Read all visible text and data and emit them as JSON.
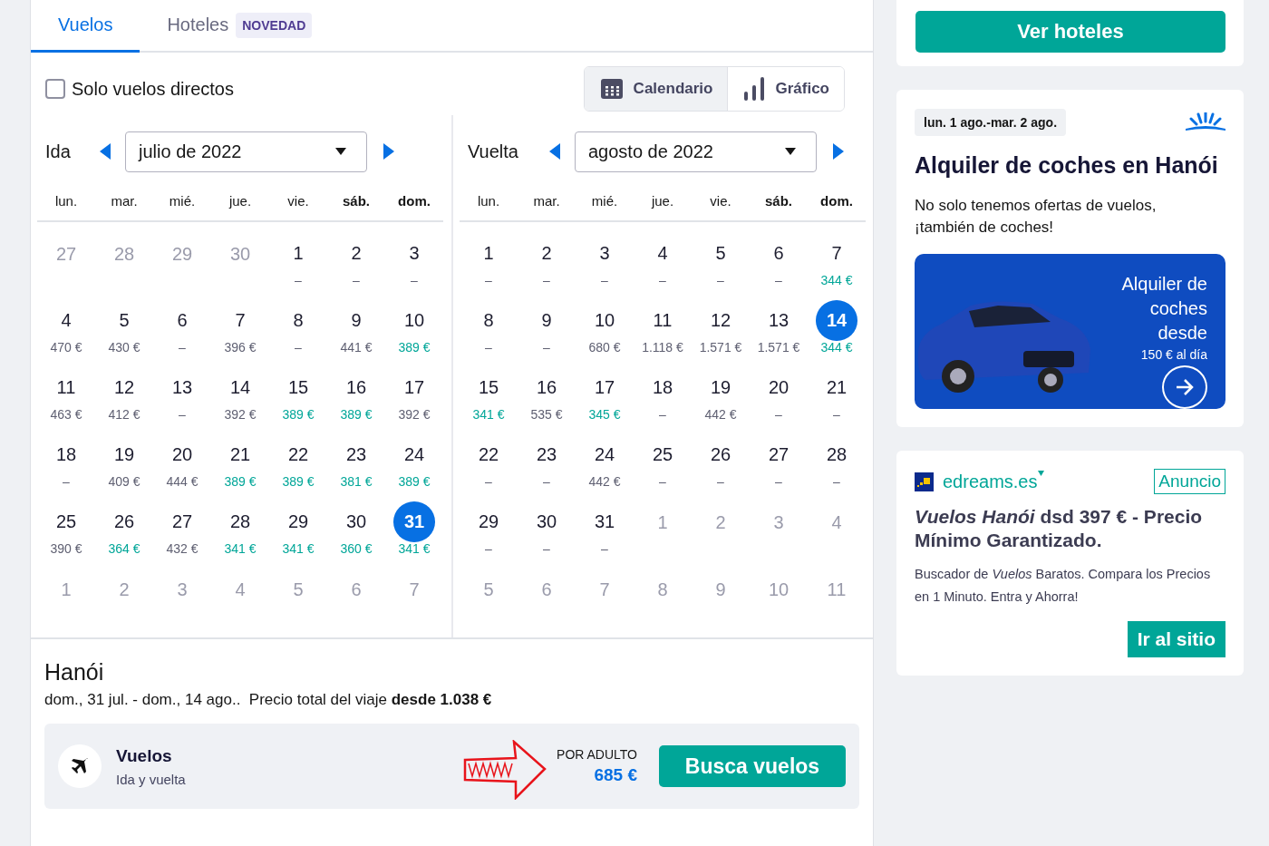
{
  "tabs": [
    {
      "label": "Vuelos",
      "selected": true
    },
    {
      "label": "Hoteles",
      "selected": false,
      "badge": "NOVEDAD"
    }
  ],
  "direct_only": {
    "label": "Solo vuelos directos",
    "checked": false
  },
  "view_toggle": [
    {
      "label": "Calendario",
      "kind": "calendar",
      "selected": true
    },
    {
      "label": "Gráfico",
      "kind": "chart",
      "selected": false
    }
  ],
  "months": [
    {
      "label": "Ida",
      "month": "julio de 2022",
      "weekdays": [
        {
          "label": "lun.",
          "weekend": false
        },
        {
          "label": "mar.",
          "weekend": false
        },
        {
          "label": "mié.",
          "weekend": false
        },
        {
          "label": "jue.",
          "weekend": false
        },
        {
          "label": "vie.",
          "weekend": false
        },
        {
          "label": "sáb.",
          "weekend": true
        },
        {
          "label": "dom.",
          "weekend": true
        }
      ],
      "days": [
        {
          "day": "27",
          "outside": true,
          "selected": false
        },
        {
          "day": "28",
          "outside": true,
          "selected": false
        },
        {
          "day": "29",
          "outside": true,
          "selected": false
        },
        {
          "day": "30",
          "outside": true,
          "selected": false
        },
        {
          "day": "1",
          "price": "–",
          "outside": false,
          "cheap": false,
          "selected": false
        },
        {
          "day": "2",
          "price": "–",
          "outside": false,
          "cheap": false,
          "selected": false
        },
        {
          "day": "3",
          "price": "–",
          "outside": false,
          "cheap": false,
          "selected": false
        },
        {
          "day": "4",
          "price": "470 €",
          "outside": false,
          "cheap": false,
          "selected": false
        },
        {
          "day": "5",
          "price": "430 €",
          "outside": false,
          "cheap": false,
          "selected": false
        },
        {
          "day": "6",
          "price": "–",
          "outside": false,
          "cheap": false,
          "selected": false
        },
        {
          "day": "7",
          "price": "396 €",
          "outside": false,
          "cheap": false,
          "selected": false
        },
        {
          "day": "8",
          "price": "–",
          "outside": false,
          "cheap": false,
          "selected": false
        },
        {
          "day": "9",
          "price": "441 €",
          "outside": false,
          "cheap": false,
          "selected": false
        },
        {
          "day": "10",
          "price": "389 €",
          "outside": false,
          "cheap": true,
          "selected": false
        },
        {
          "day": "11",
          "price": "463 €",
          "outside": false,
          "cheap": false,
          "selected": false
        },
        {
          "day": "12",
          "price": "412 €",
          "outside": false,
          "cheap": false,
          "selected": false
        },
        {
          "day": "13",
          "price": "–",
          "outside": false,
          "cheap": false,
          "selected": false
        },
        {
          "day": "14",
          "price": "392 €",
          "outside": false,
          "cheap": false,
          "selected": false
        },
        {
          "day": "15",
          "price": "389 €",
          "outside": false,
          "cheap": true,
          "selected": false
        },
        {
          "day": "16",
          "price": "389 €",
          "outside": false,
          "cheap": true,
          "selected": false
        },
        {
          "day": "17",
          "price": "392 €",
          "outside": false,
          "cheap": false,
          "selected": false
        },
        {
          "day": "18",
          "price": "–",
          "outside": false,
          "cheap": false,
          "selected": false
        },
        {
          "day": "19",
          "price": "409 €",
          "outside": false,
          "cheap": false,
          "selected": false
        },
        {
          "day": "20",
          "price": "444 €",
          "outside": false,
          "cheap": false,
          "selected": false
        },
        {
          "day": "21",
          "price": "389 €",
          "outside": false,
          "cheap": true,
          "selected": false
        },
        {
          "day": "22",
          "price": "389 €",
          "outside": false,
          "cheap": true,
          "selected": false
        },
        {
          "day": "23",
          "price": "381 €",
          "outside": false,
          "cheap": true,
          "selected": false
        },
        {
          "day": "24",
          "price": "389 €",
          "outside": false,
          "cheap": true,
          "selected": false
        },
        {
          "day": "25",
          "price": "390 €",
          "outside": false,
          "cheap": false,
          "selected": false
        },
        {
          "day": "26",
          "price": "364 €",
          "outside": false,
          "cheap": true,
          "selected": false
        },
        {
          "day": "27",
          "price": "432 €",
          "outside": false,
          "cheap": false,
          "selected": false
        },
        {
          "day": "28",
          "price": "341 €",
          "outside": false,
          "cheap": true,
          "selected": false
        },
        {
          "day": "29",
          "price": "341 €",
          "outside": false,
          "cheap": true,
          "selected": false
        },
        {
          "day": "30",
          "price": "360 €",
          "outside": false,
          "cheap": true,
          "selected": false
        },
        {
          "day": "31",
          "price": "341 €",
          "outside": false,
          "cheap": true,
          "selected": true
        },
        {
          "day": "1",
          "outside": true,
          "selected": false
        },
        {
          "day": "2",
          "outside": true,
          "selected": false
        },
        {
          "day": "3",
          "outside": true,
          "selected": false
        },
        {
          "day": "4",
          "outside": true,
          "selected": false
        },
        {
          "day": "5",
          "outside": true,
          "selected": false
        },
        {
          "day": "6",
          "outside": true,
          "selected": false
        },
        {
          "day": "7",
          "outside": true,
          "selected": false
        }
      ]
    },
    {
      "label": "Vuelta",
      "month": "agosto de 2022",
      "weekdays": [
        {
          "label": "lun.",
          "weekend": false
        },
        {
          "label": "mar.",
          "weekend": false
        },
        {
          "label": "mié.",
          "weekend": false
        },
        {
          "label": "jue.",
          "weekend": false
        },
        {
          "label": "vie.",
          "weekend": false
        },
        {
          "label": "sáb.",
          "weekend": true
        },
        {
          "label": "dom.",
          "weekend": true
        }
      ],
      "days": [
        {
          "day": "1",
          "price": "–",
          "outside": false,
          "cheap": false,
          "selected": false
        },
        {
          "day": "2",
          "price": "–",
          "outside": false,
          "cheap": false,
          "selected": false
        },
        {
          "day": "3",
          "price": "–",
          "outside": false,
          "cheap": false,
          "selected": false
        },
        {
          "day": "4",
          "price": "–",
          "outside": false,
          "cheap": false,
          "selected": false
        },
        {
          "day": "5",
          "price": "–",
          "outside": false,
          "cheap": false,
          "selected": false
        },
        {
          "day": "6",
          "price": "–",
          "outside": false,
          "cheap": false,
          "selected": false
        },
        {
          "day": "7",
          "price": "344 €",
          "outside": false,
          "cheap": true,
          "selected": false
        },
        {
          "day": "8",
          "price": "–",
          "outside": false,
          "cheap": false,
          "selected": false
        },
        {
          "day": "9",
          "price": "–",
          "outside": false,
          "cheap": false,
          "selected": false
        },
        {
          "day": "10",
          "price": "680 €",
          "outside": false,
          "cheap": false,
          "selected": false
        },
        {
          "day": "11",
          "price": "1.118 €",
          "outside": false,
          "cheap": false,
          "selected": false
        },
        {
          "day": "12",
          "price": "1.571 €",
          "outside": false,
          "cheap": false,
          "selected": false
        },
        {
          "day": "13",
          "price": "1.571 €",
          "outside": false,
          "cheap": false,
          "selected": false
        },
        {
          "day": "14",
          "price": "344 €",
          "outside": false,
          "cheap": true,
          "selected": true
        },
        {
          "day": "15",
          "price": "341 €",
          "outside": false,
          "cheap": true,
          "selected": false
        },
        {
          "day": "16",
          "price": "535 €",
          "outside": false,
          "cheap": false,
          "selected": false
        },
        {
          "day": "17",
          "price": "345 €",
          "outside": false,
          "cheap": true,
          "selected": false
        },
        {
          "day": "18",
          "price": "–",
          "outside": false,
          "cheap": false,
          "selected": false
        },
        {
          "day": "19",
          "price": "442 €",
          "outside": false,
          "cheap": false,
          "selected": false
        },
        {
          "day": "20",
          "price": "–",
          "outside": false,
          "cheap": false,
          "selected": false
        },
        {
          "day": "21",
          "price": "–",
          "outside": false,
          "cheap": false,
          "selected": false
        },
        {
          "day": "22",
          "price": "–",
          "outside": false,
          "cheap": false,
          "selected": false
        },
        {
          "day": "23",
          "price": "–",
          "outside": false,
          "cheap": false,
          "selected": false
        },
        {
          "day": "24",
          "price": "442 €",
          "outside": false,
          "cheap": false,
          "selected": false
        },
        {
          "day": "25",
          "price": "–",
          "outside": false,
          "cheap": false,
          "selected": false
        },
        {
          "day": "26",
          "price": "–",
          "outside": false,
          "cheap": false,
          "selected": false
        },
        {
          "day": "27",
          "price": "–",
          "outside": false,
          "cheap": false,
          "selected": false
        },
        {
          "day": "28",
          "price": "–",
          "outside": false,
          "cheap": false,
          "selected": false
        },
        {
          "day": "29",
          "price": "–",
          "outside": false,
          "cheap": false,
          "selected": false
        },
        {
          "day": "30",
          "price": "–",
          "outside": false,
          "cheap": false,
          "selected": false
        },
        {
          "day": "31",
          "price": "–",
          "outside": false,
          "cheap": false,
          "selected": false
        },
        {
          "day": "1",
          "outside": true,
          "selected": false
        },
        {
          "day": "2",
          "outside": true,
          "selected": false
        },
        {
          "day": "3",
          "outside": true,
          "selected": false
        },
        {
          "day": "4",
          "outside": true,
          "selected": false
        },
        {
          "day": "5",
          "outside": true,
          "selected": false
        },
        {
          "day": "6",
          "outside": true,
          "selected": false
        },
        {
          "day": "7",
          "outside": true,
          "selected": false
        },
        {
          "day": "8",
          "outside": true,
          "selected": false
        },
        {
          "day": "9",
          "outside": true,
          "selected": false
        },
        {
          "day": "10",
          "outside": true,
          "selected": false
        },
        {
          "day": "11",
          "outside": true,
          "selected": false
        }
      ]
    }
  ],
  "summary": {
    "city": "Hanói",
    "details": "dom., 31 jul. - dom., 14 ago..  Precio total del viaje **desde 1.038 €**",
    "flight": {
      "title": "Vuelos",
      "subtitle": "Ida y vuelta",
      "price_label": "POR ADULTO",
      "price": "685 €",
      "button": "Busca vuelos"
    }
  },
  "hotel_card": {
    "button": "Ver hoteles"
  },
  "car_card": {
    "dates": "lun. 1 ago.-mar. 2 ago.",
    "title": "Alquiler de coches en Hanói",
    "text": "No solo tenemos ofertas de vuelos, ¡también de coches!",
    "promo": "Alquiler de coches desde",
    "promo_price": "150 € al día"
  },
  "ad": {
    "domain": "edreams.es",
    "label": "Anuncio",
    "title": "*Vuelos Hanói* dsd 397 € - Precio Mínimo Garantizado.",
    "text": "Buscador de *Vuelos* Baratos. Compara los Precios en 1 Minuto. Entra y Ahorra!",
    "button": "Ir al sitio"
  }
}
